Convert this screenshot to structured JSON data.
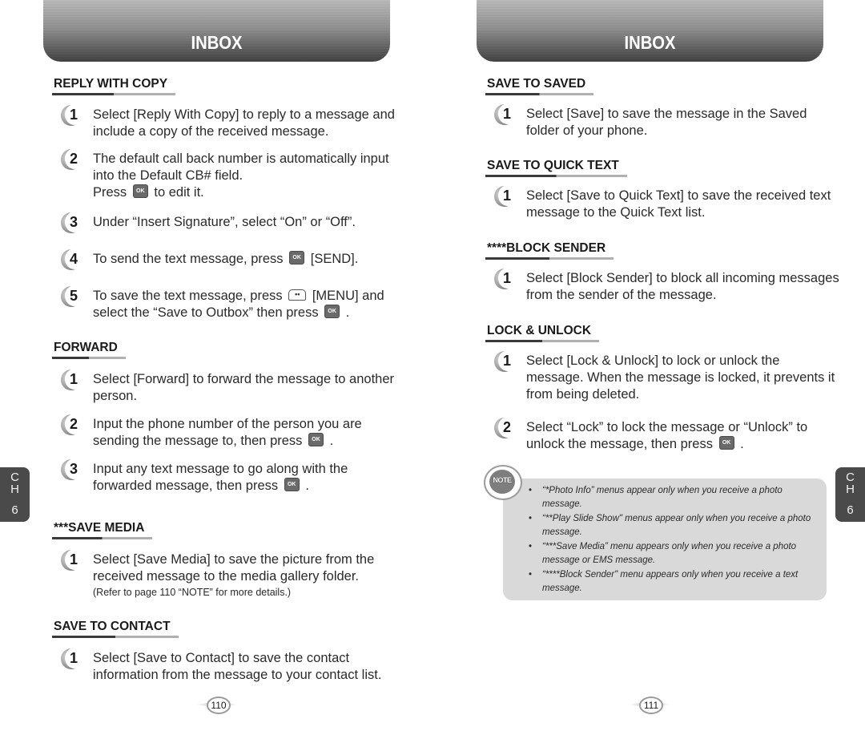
{
  "left_page": {
    "banner_title": "INBOX",
    "page_number": "110",
    "chapter_tab": {
      "c": "C",
      "h": "H",
      "n": "6"
    },
    "sections": [
      {
        "heading": "REPLY WITH COPY",
        "steps": [
          {
            "num": "1",
            "text": "Select [Reply With Copy] to reply to a message and include a copy of the received message."
          },
          {
            "num": "2",
            "text_a": "The default call back number is automatically input into the Default CB# field.",
            "text_b": "Press",
            "text_c": "to edit it."
          },
          {
            "num": "3",
            "text": "Under “Insert Signature”, select “On” or “Off”."
          },
          {
            "num": "4",
            "text_a": "To send the text message, press",
            "text_b": "[SEND]."
          },
          {
            "num": "5",
            "text_a": "To save the text message, press",
            "text_b": "[MENU] and select the “Save to Outbox” then press",
            "text_c": "."
          }
        ]
      },
      {
        "heading": "FORWARD",
        "steps": [
          {
            "num": "1",
            "text": "Select [Forward] to forward the message to another person."
          },
          {
            "num": "2",
            "text_a": "Input the phone number of the person you are sending the message to, then press",
            "text_b": "."
          },
          {
            "num": "3",
            "text_a": "Input any text message to go along with the forwarded message, then press",
            "text_b": "."
          }
        ]
      },
      {
        "heading": "***SAVE MEDIA",
        "steps": [
          {
            "num": "1",
            "text": "Select [Save Media] to save the picture from the received message to the media gallery folder.",
            "small": "(Refer to page 110 “NOTE” for more details.)"
          }
        ]
      },
      {
        "heading": "SAVE TO CONTACT",
        "steps": [
          {
            "num": "1",
            "text": "Select [Save to Contact] to save the contact information from the message to your contact list."
          }
        ]
      }
    ]
  },
  "right_page": {
    "banner_title": "INBOX",
    "page_number": "111",
    "chapter_tab": {
      "c": "C",
      "h": "H",
      "n": "6"
    },
    "sections": [
      {
        "heading": "SAVE TO SAVED",
        "steps": [
          {
            "num": "1",
            "text": "Select [Save] to save the message in the Saved folder of your phone."
          }
        ]
      },
      {
        "heading": "SAVE TO QUICK TEXT",
        "steps": [
          {
            "num": "1",
            "text": "Select [Save to Quick Text] to save the received text message to the Quick Text list."
          }
        ]
      },
      {
        "heading": "****BLOCK SENDER",
        "steps": [
          {
            "num": "1",
            "text": "Select [Block Sender] to block all incoming messages from the sender of the message."
          }
        ]
      },
      {
        "heading": "LOCK & UNLOCK",
        "steps": [
          {
            "num": "1",
            "text": "Select [Lock & Unlock] to lock or unlock the message. When the message is locked, it prevents it from being deleted."
          },
          {
            "num": "2",
            "text_a": "Select “Lock” to lock the message or “Unlock” to unlock the message, then press",
            "text_b": "."
          }
        ]
      }
    ],
    "note": {
      "icon_label": "NOTE",
      "items": [
        "“*Photo Info”  menus appear only when you receive a photo message.",
        "“**Play Slide Show\" menus appear only when you receive a photo message.",
        "“***Save Media”  menu appears only when you receive a photo message or EMS message.",
        "“****Block Sender\" menu appears only when you receive a text message."
      ]
    }
  },
  "keys": {
    "ok": "OK",
    "menu": "••"
  }
}
